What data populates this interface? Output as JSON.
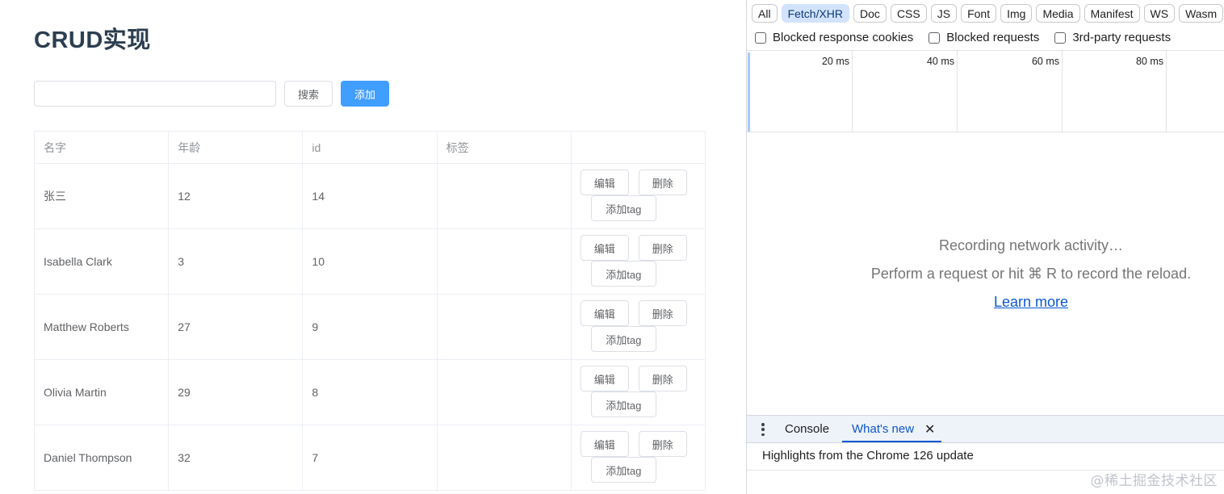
{
  "app": {
    "title": "CRUD实现",
    "search": {
      "value": "",
      "placeholder": ""
    },
    "search_label": "搜索",
    "add_label": "添加",
    "columns": [
      "名字",
      "年龄",
      "id",
      "标签",
      ""
    ],
    "rows": [
      {
        "name": "张三",
        "age": "12",
        "id": "14",
        "tags": ""
      },
      {
        "name": "Isabella Clark",
        "age": "3",
        "id": "10",
        "tags": ""
      },
      {
        "name": "Matthew Roberts",
        "age": "27",
        "id": "9",
        "tags": ""
      },
      {
        "name": "Olivia Martin",
        "age": "29",
        "id": "8",
        "tags": ""
      },
      {
        "name": "Daniel Thompson",
        "age": "32",
        "id": "7",
        "tags": ""
      }
    ],
    "actions": {
      "edit": "编辑",
      "delete": "删除",
      "add_tag": "添加tag"
    }
  },
  "devtools": {
    "filters": [
      "All",
      "Fetch/XHR",
      "Doc",
      "CSS",
      "JS",
      "Font",
      "Img",
      "Media",
      "Manifest",
      "WS",
      "Wasm"
    ],
    "active_filter": "Fetch/XHR",
    "checkboxes": [
      "Blocked response cookies",
      "Blocked requests",
      "3rd-party requests"
    ],
    "timeline_ticks": [
      "20 ms",
      "40 ms",
      "60 ms",
      "80 ms"
    ],
    "empty_line1": "Recording network activity…",
    "empty_line2": "Perform a request or hit ⌘ R to record the reload.",
    "learn_more": "Learn more",
    "drawer": {
      "tabs": [
        "Console",
        "What's new"
      ],
      "active_tab": "What's new",
      "content": "Highlights from the Chrome 126 update"
    }
  },
  "watermark": "@稀土掘金技术社区"
}
